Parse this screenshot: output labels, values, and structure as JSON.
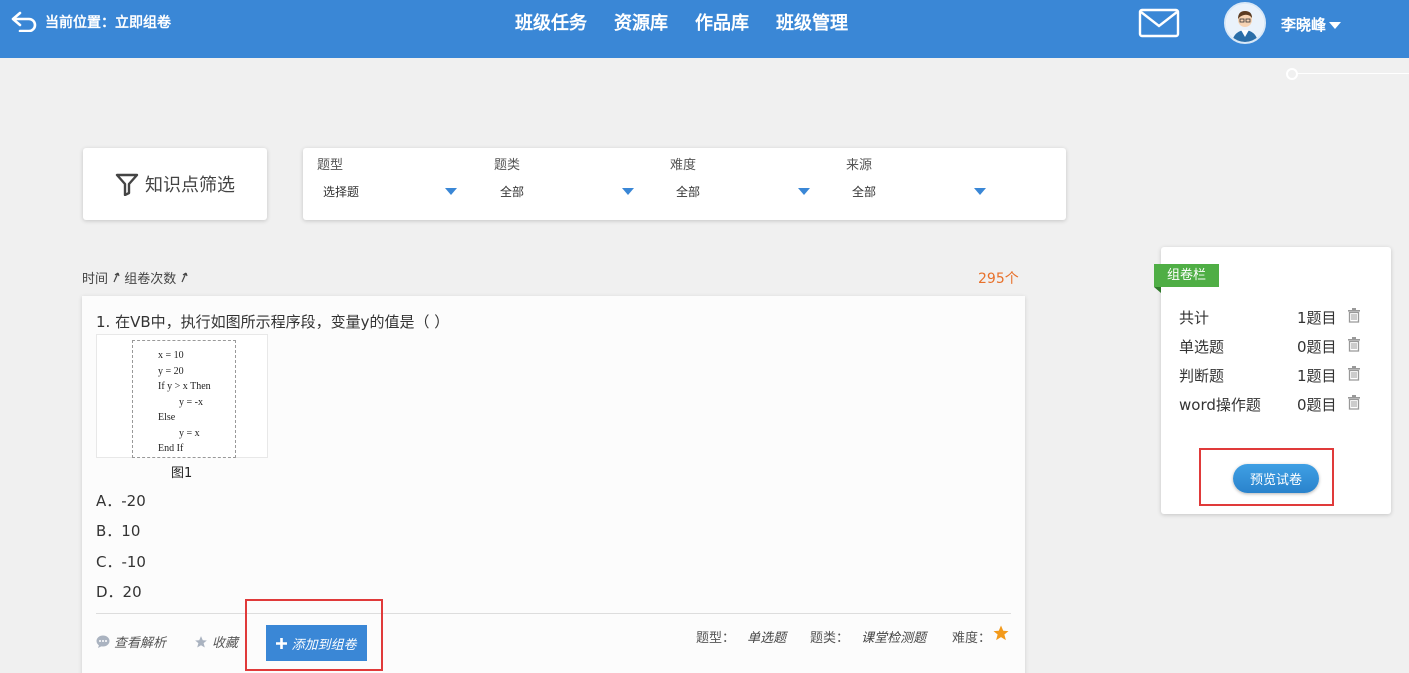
{
  "header": {
    "breadcrumb": "当前位置：立即组卷",
    "nav": [
      "班级任务",
      "资源库",
      "作品库",
      "班级管理"
    ],
    "user_name": "李晓峰"
  },
  "filters": {
    "knowledge_button": "知识点筛选",
    "groups": [
      {
        "label": "题型",
        "value": "选择题"
      },
      {
        "label": "题类",
        "value": "全部"
      },
      {
        "label": "难度",
        "value": "全部"
      },
      {
        "label": "来源",
        "value": "全部"
      }
    ]
  },
  "sort": {
    "time": "时间",
    "count": "组卷次数"
  },
  "total_count": "295个",
  "question": {
    "title": "1. 在VB中，执行如图所示程序段，变量y的值是（ ）",
    "code": [
      "x = 10",
      "y = 20",
      "If y > x Then",
      "y = -x",
      "Else",
      "y = x",
      "End If"
    ],
    "caption": "图1",
    "options": [
      "A．-20",
      "B．10",
      "C．-10",
      "D．20"
    ],
    "actions": {
      "analysis": "查看解析",
      "favorite": "收藏",
      "add": "添加到组卷"
    },
    "meta": {
      "type_label": "题型：",
      "type_value": "单选题",
      "category_label": "题类：",
      "category_value": "课堂检测题",
      "difficulty_label": "难度：",
      "difficulty_stars": 1
    }
  },
  "compose": {
    "tag": "组卷栏",
    "rows": [
      {
        "label": "共计",
        "count": "1题目"
      },
      {
        "label": "单选题",
        "count": "0题目"
      },
      {
        "label": "判断题",
        "count": "1题目"
      },
      {
        "label": "word操作题",
        "count": "0题目"
      }
    ],
    "preview_button": "预览试卷"
  },
  "colors": {
    "header": "#3a87d6",
    "accent": "#e8712b",
    "tag": "#4fae45",
    "highlight": "#e03a3a"
  }
}
